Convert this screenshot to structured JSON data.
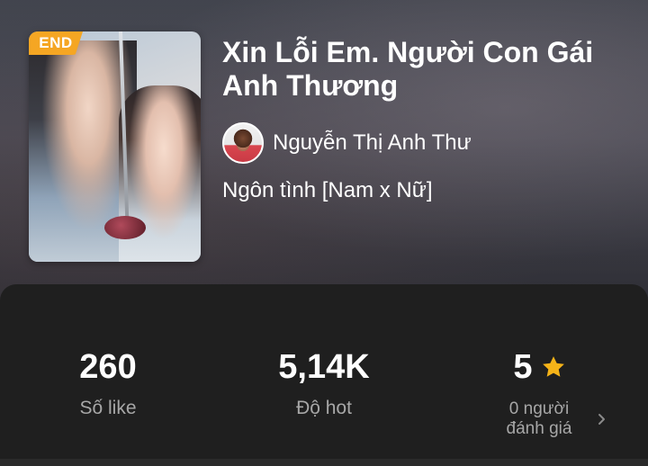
{
  "book": {
    "status_badge": "END",
    "title": "Xin Lỗi Em. Người Con Gái Anh Thương",
    "author": "Nguyễn Thị Anh Thư",
    "genre": "Ngôn tình [Nam x Nữ]"
  },
  "stats": {
    "likes": {
      "value": "260",
      "label": "Số like"
    },
    "hot": {
      "value": "5,14K",
      "label": "Độ hot"
    },
    "rating": {
      "value": "5",
      "label": "0 người đánh giá",
      "icon": "star-icon"
    }
  },
  "colors": {
    "badge": "#f5a623",
    "star": "#f5b318",
    "panel": "#1f1f1f",
    "muted_text": "#a7a7a7"
  }
}
